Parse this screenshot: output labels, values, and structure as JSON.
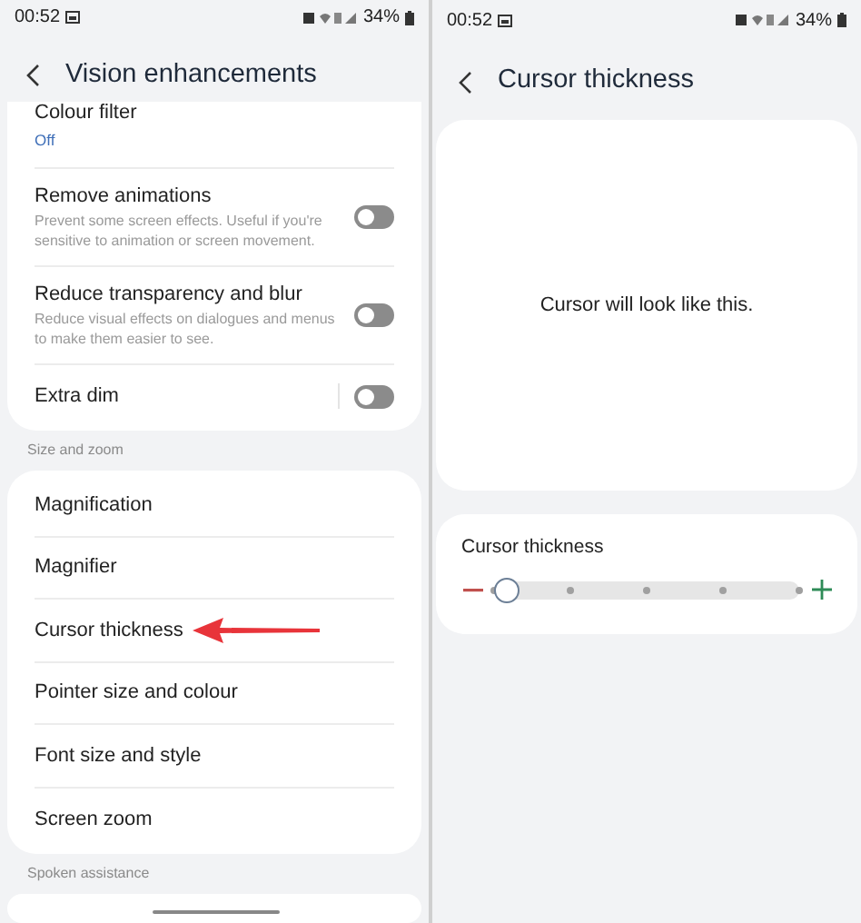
{
  "screens": [
    {
      "status_bar": {
        "time": "00:52",
        "battery": "34%"
      },
      "title": "Vision enhancements",
      "groups": [
        {
          "items": [
            {
              "kind": "value",
              "title": "Colour filter",
              "value": "Off"
            },
            {
              "kind": "toggle",
              "title": "Remove animations",
              "description": "Prevent some screen effects. Useful if you're sensitive to animation or screen movement.",
              "on": false
            },
            {
              "kind": "toggle",
              "title": "Reduce transparency and blur",
              "description": "Reduce visual effects on dialogues and menus to make them easier to see.",
              "on": false
            },
            {
              "kind": "toggle",
              "title": "Extra dim",
              "on": false
            }
          ]
        },
        {
          "label": "Size and zoom",
          "items": [
            {
              "kind": "link",
              "title": "Magnification"
            },
            {
              "kind": "link",
              "title": "Magnifier"
            },
            {
              "kind": "link",
              "title": "Cursor thickness",
              "annotated": true
            },
            {
              "kind": "link",
              "title": "Pointer size and colour"
            },
            {
              "kind": "link",
              "title": "Font size and style"
            },
            {
              "kind": "link",
              "title": "Screen zoom"
            }
          ]
        },
        {
          "label": "Spoken assistance"
        }
      ]
    },
    {
      "status_bar": {
        "time": "00:52",
        "battery": "34%"
      },
      "title": "Cursor thickness",
      "preview": "Cursor will look like this.",
      "slider": {
        "label": "Cursor thickness",
        "level": 0
      }
    }
  ]
}
